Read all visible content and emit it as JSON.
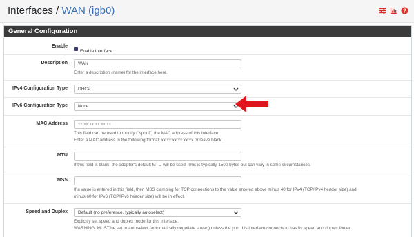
{
  "breadcrumb": {
    "parent": "Interfaces",
    "separator": "/",
    "current": "WAN (igb0)"
  },
  "header_icons": [
    "sliders-icon",
    "bar-chart-icon",
    "help-icon"
  ],
  "panel": {
    "title": "General Configuration"
  },
  "enable": {
    "label": "Enable",
    "checkbox_label": "Enable interface",
    "checked": true
  },
  "description": {
    "label": "Description",
    "value": "WAN",
    "help": "Enter a description (name) for the interface here."
  },
  "ipv4": {
    "label": "IPv4 Configuration Type",
    "selected": "DHCP"
  },
  "ipv6": {
    "label": "IPv6 Configuration Type",
    "selected": "None"
  },
  "mac": {
    "label": "MAC Address",
    "placeholder": "xx:xx:xx:xx:xx:xx",
    "help1": "This field can be used to modify (\"spoof\") the MAC address of this interface.",
    "help2": "Enter a MAC address in the following format: xx:xx:xx:xx:xx:xx or leave blank."
  },
  "mtu": {
    "label": "MTU",
    "value": "",
    "help": "If this field is blank, the adapter's default MTU will be used. This is typically 1500 bytes but can vary in some circumstances."
  },
  "mss": {
    "label": "MSS",
    "value": "",
    "help1": "If a value is entered in this field, then MSS clamping for TCP connections to the value entered above minus 40 for IPv4 (TCP/IPv4 header size) and",
    "help2": "minus 60 for IPv6 (TCP/IPv6 header size) will be in effect."
  },
  "speed": {
    "label": "Speed and Duplex",
    "selected": "Default (no preference, typically autoselect)",
    "help1": "Explicitly set speed and duplex mode for this interface.",
    "help2": "WARNING: MUST be set to autoselect (automatically negotiate speed) unless the port this interface connects to has its speed and duplex forced."
  },
  "colors": {
    "arrow": "#e0141c",
    "panel_header": "#3b3b3b",
    "link": "#3a6fb0",
    "icon_red": "#d9322c"
  }
}
